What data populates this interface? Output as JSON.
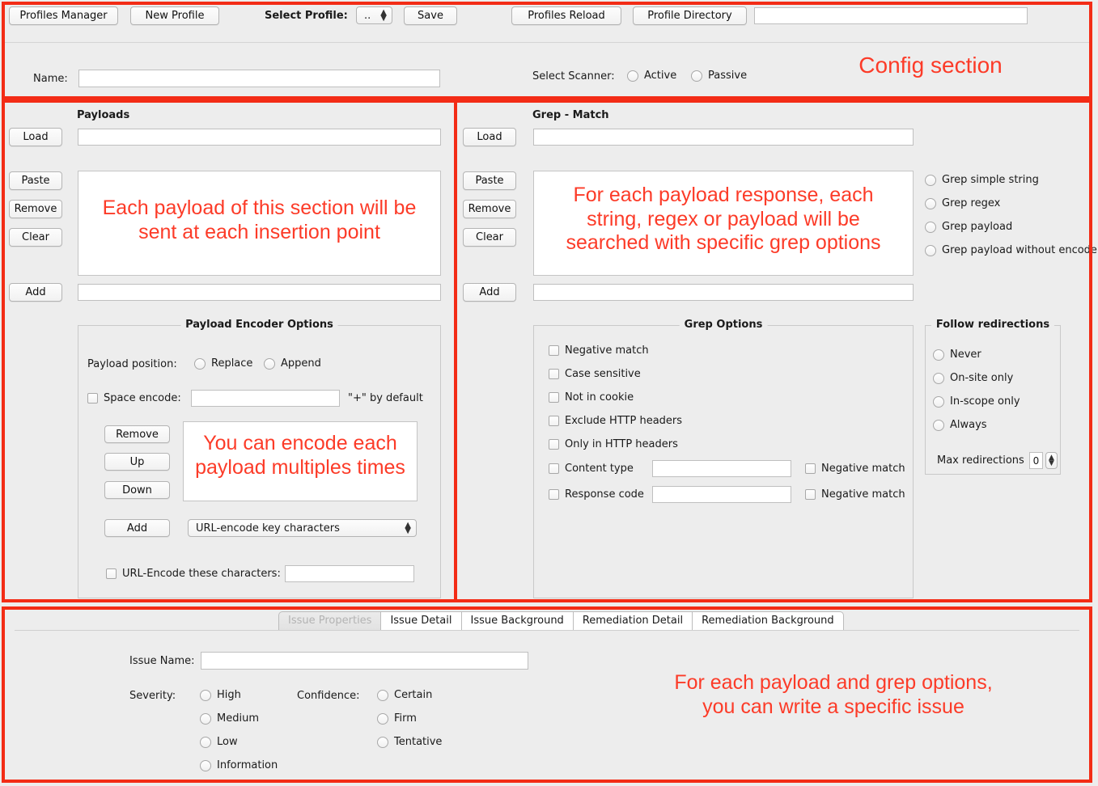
{
  "colors": {
    "annotation_red": "#fc3b28",
    "frame_red": "#f32c16",
    "background": "#ededed",
    "field_white": "#ffffff"
  },
  "config": {
    "annotation": "Config section",
    "buttons": {
      "profiles_manager": "Profiles Manager",
      "new_profile": "New Profile",
      "save": "Save",
      "profiles_reload": "Profiles Reload",
      "profile_directory": "Profile Directory"
    },
    "select_profile_label": "Select Profile:",
    "select_profile_value": "..",
    "profile_directory_value": "",
    "name_label": "Name:",
    "name_value": "",
    "select_scanner_label": "Select Scanner:",
    "scanner_options": [
      "Active",
      "Passive"
    ]
  },
  "payloads": {
    "title": "Payloads",
    "annotation": "Each payload of this section will be\nsent at each insertion point",
    "buttons": {
      "load": "Load",
      "paste": "Paste",
      "remove": "Remove",
      "clear": "Clear",
      "add": "Add"
    },
    "load_value": "",
    "add_value": "",
    "encoder": {
      "title": "Payload Encoder Options",
      "annotation": "You can encode each\npayload multiples times",
      "position_label": "Payload position:",
      "position_options": [
        "Replace",
        "Append"
      ],
      "space_encode_label": "Space encode:",
      "space_encode_value": "",
      "space_encode_hint": "\"+\" by default",
      "buttons": {
        "remove": "Remove",
        "up": "Up",
        "down": "Down",
        "add": "Add"
      },
      "encoder_select_value": "URL-encode key characters",
      "url_encode_chars_label": "URL-Encode these characters:",
      "url_encode_chars_value": ""
    }
  },
  "grep": {
    "title": "Grep - Match",
    "annotation": "For each payload response, each\nstring, regex or payload will be\nsearched with specific grep options",
    "buttons": {
      "load": "Load",
      "paste": "Paste",
      "remove": "Remove",
      "clear": "Clear",
      "add": "Add"
    },
    "load_value": "",
    "add_value": "",
    "modes": [
      "Grep simple string",
      "Grep regex",
      "Grep payload",
      "Grep payload without encode"
    ],
    "options": {
      "title": "Grep Options",
      "checkboxes": [
        "Negative match",
        "Case sensitive",
        "Not in cookie",
        "Exclude HTTP headers",
        "Only in HTTP headers"
      ],
      "content_type_label": "Content type",
      "content_type_value": "",
      "content_type_negative": "Negative match",
      "response_code_label": "Response code",
      "response_code_value": "",
      "response_code_negative": "Negative match"
    },
    "redirections": {
      "title": "Follow redirections",
      "options": [
        "Never",
        "On-site only",
        "In-scope only",
        "Always"
      ],
      "max_label": "Max redirections",
      "max_value": "0"
    }
  },
  "issue": {
    "annotation": "For each payload and grep options,\nyou can write a specific issue",
    "tabs": [
      "Issue Properties",
      "Issue Detail",
      "Issue Background",
      "Remediation Detail",
      "Remediation Background"
    ],
    "issue_name_label": "Issue Name:",
    "issue_name_value": "",
    "severity_label": "Severity:",
    "severity_options": [
      "High",
      "Medium",
      "Low",
      "Information"
    ],
    "confidence_label": "Confidence:",
    "confidence_options": [
      "Certain",
      "Firm",
      "Tentative"
    ]
  }
}
